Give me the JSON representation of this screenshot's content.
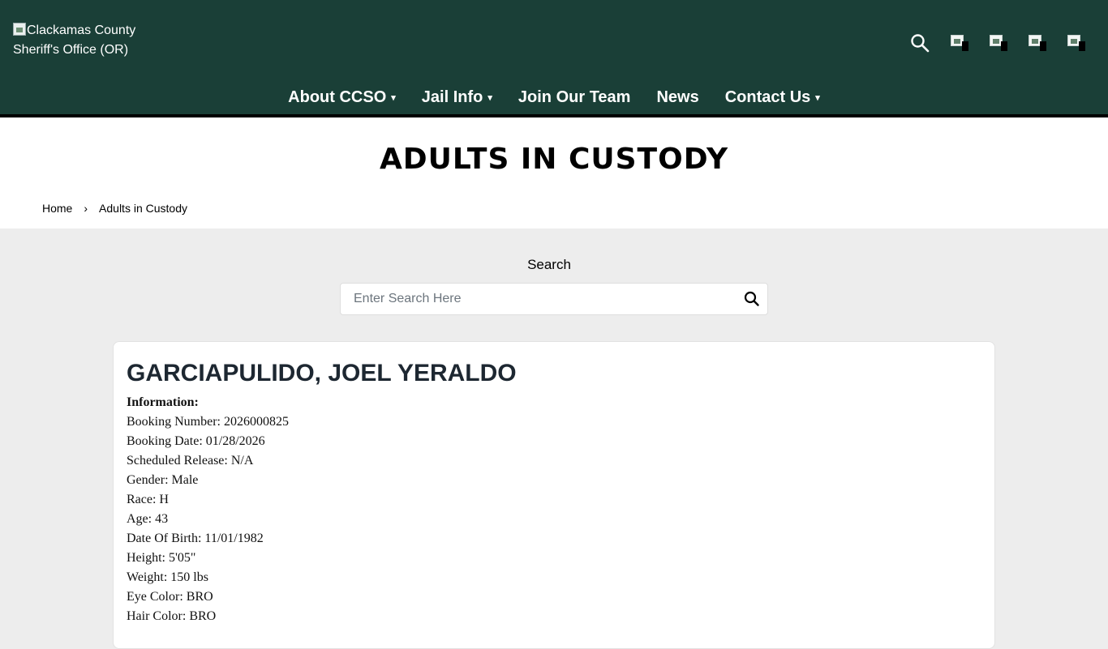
{
  "header": {
    "logo_alt": "Clackamas County Sheriff's Office (OR)",
    "icons": [
      "search-icon",
      "facebook-icon",
      "twitter-icon",
      "instagram-icon",
      "youtube-icon"
    ]
  },
  "nav": {
    "about": "About CCSO",
    "jail": "Jail Info",
    "join": "Join Our Team",
    "news": "News",
    "contact": "Contact Us",
    "caret": "▾"
  },
  "page": {
    "title": "ADULTS IN CUSTODY"
  },
  "breadcrumb": {
    "home": "Home",
    "separator": "›",
    "current": "Adults in Custody"
  },
  "search": {
    "label": "Search",
    "placeholder": "Enter Search Here"
  },
  "inmate": {
    "name": "GARCIAPULIDO, JOEL YERALDO",
    "info_heading": "Information:",
    "fields": [
      "Booking Number: 2026000825",
      "Booking Date: 01/28/2026",
      "Scheduled Release: N/A",
      "Gender: Male",
      "Race: H",
      "Age: 43",
      "Date Of Birth: 11/01/1982",
      "Height: 5'05\"",
      "Weight: 150 lbs",
      "Eye Color: BRO",
      "Hair Color: BRO"
    ]
  },
  "colors": {
    "header_bg": "#1a3f37",
    "page_bg": "#ededed",
    "name_color": "#1d2731"
  }
}
